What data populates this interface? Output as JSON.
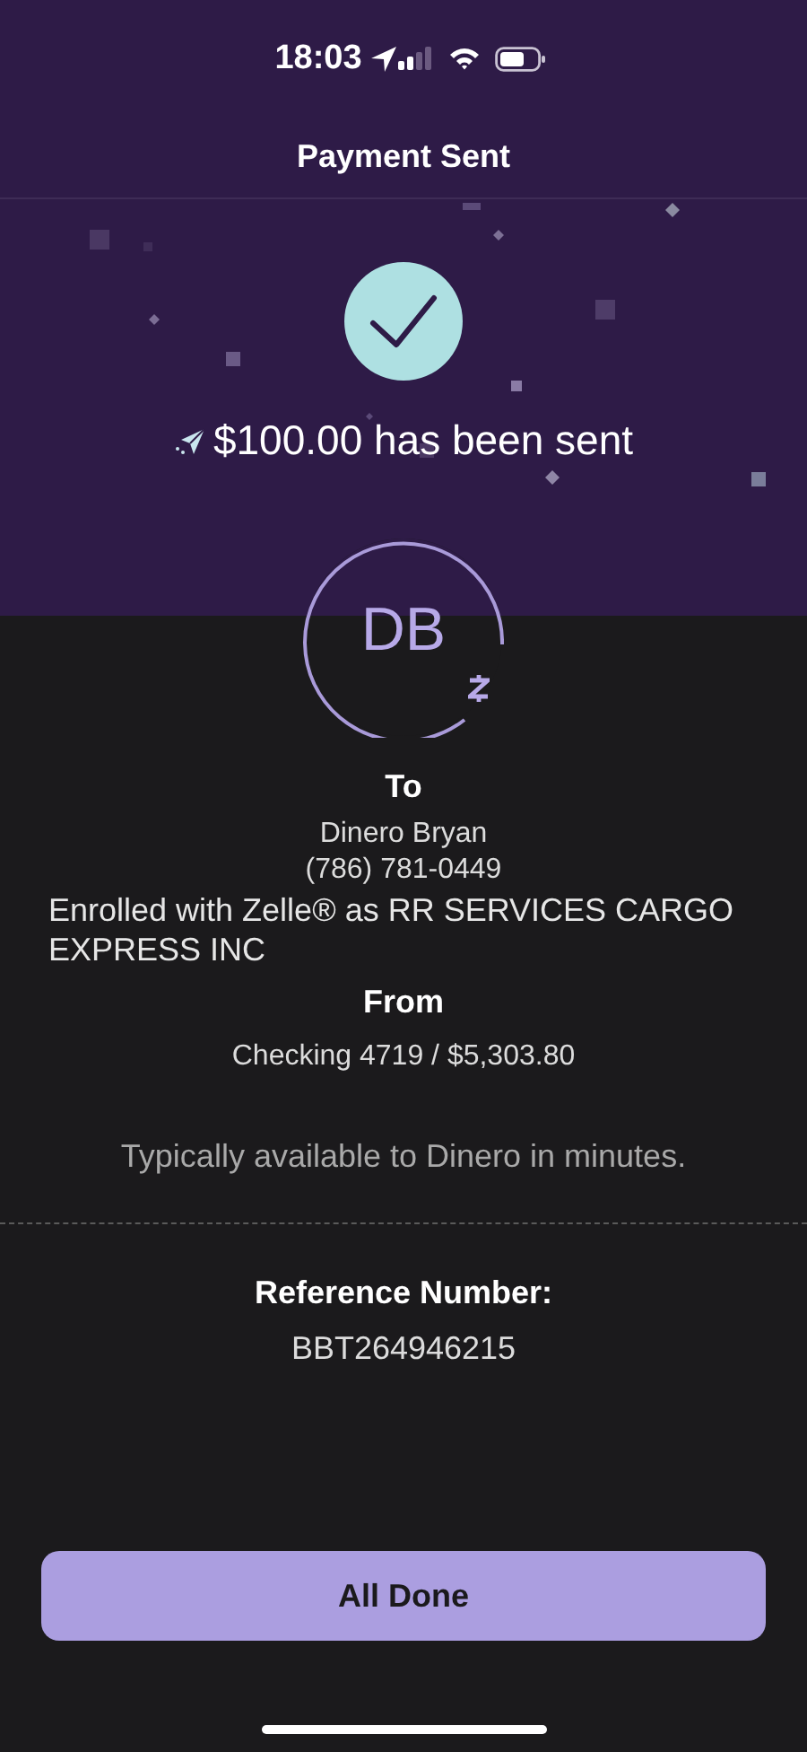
{
  "status_bar": {
    "time": "18:03"
  },
  "title": "Payment Sent",
  "confirmation": {
    "message": "$100.00 has been sent"
  },
  "recipient": {
    "initials": "DB",
    "label": "To",
    "name": "Dinero Bryan",
    "phone": "(786) 781-0449",
    "enrollment": "Enrolled with Zelle® as RR SERVICES CARGO EXPRESS INC"
  },
  "source": {
    "label": "From",
    "account": "Checking 4719 / $5,303.80"
  },
  "availability": "Typically available to Dinero in minutes.",
  "reference": {
    "label": "Reference Number:",
    "value": "BBT264946215"
  },
  "buttons": [
    {
      "label": "All Done",
      "kind": "primary"
    }
  ]
}
